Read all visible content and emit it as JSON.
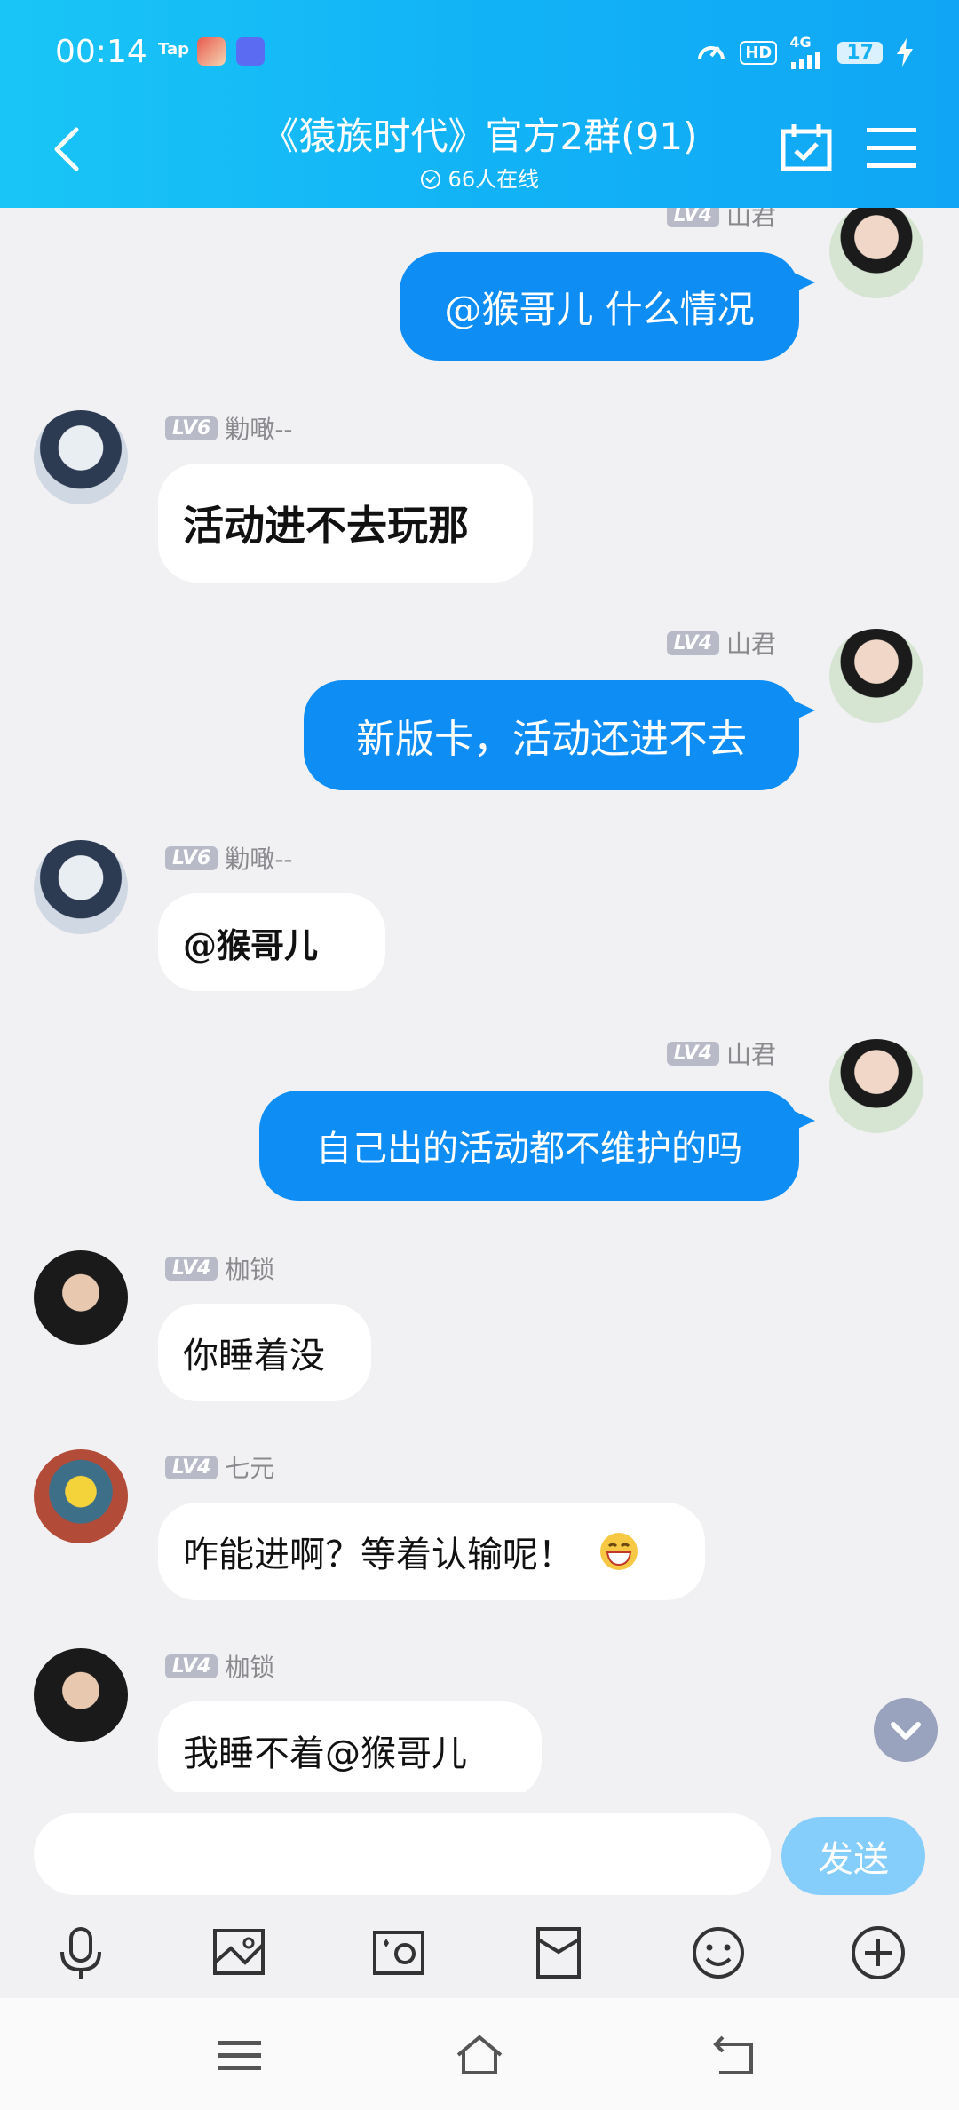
{
  "status_bar": {
    "time": "00:14",
    "tap_label": "Tap",
    "network": "4G",
    "hd": "HD",
    "battery": "17"
  },
  "header": {
    "title": "《猿族时代》官方2群(91)",
    "online": "66人在线"
  },
  "messages": [
    {
      "side": "out",
      "level": "LV4",
      "name": "山君",
      "text": "@猴哥儿 什么情况"
    },
    {
      "side": "in",
      "level": "LV6",
      "name": "勦噉--",
      "text": "活动进不去玩那"
    },
    {
      "side": "out",
      "level": "LV4",
      "name": "山君",
      "text": "新版卡，活动还进不去"
    },
    {
      "side": "in",
      "level": "LV6",
      "name": "勦噉--",
      "text": "@猴哥儿"
    },
    {
      "side": "out",
      "level": "LV4",
      "name": "山君",
      "text": "自己出的活动都不维护的吗"
    },
    {
      "side": "in",
      "level": "LV4",
      "name": "枷锁",
      "text": "你睡着没"
    },
    {
      "side": "in",
      "level": "LV4",
      "name": "七元",
      "text": "咋能进啊？等着认输呢！"
    },
    {
      "side": "in",
      "level": "LV4",
      "name": "枷锁",
      "text": "我睡不着@猴哥儿"
    }
  ],
  "input": {
    "placeholder": "",
    "value": ""
  },
  "send_label": "发送",
  "colors": {
    "accent": "#0e8df5",
    "header": "#14b4f6",
    "send_disabled": "#85cdfa"
  }
}
